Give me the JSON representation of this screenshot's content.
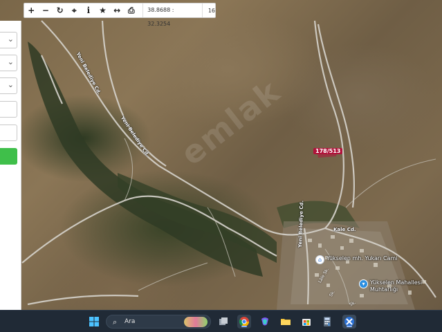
{
  "toolbar": {
    "buttons": [
      {
        "name": "zoom-in",
        "glyph": "+"
      },
      {
        "name": "zoom-out",
        "glyph": "−"
      },
      {
        "name": "refresh",
        "glyph": "↻"
      },
      {
        "name": "locate",
        "glyph": "⌖"
      },
      {
        "name": "info",
        "glyph": "i"
      },
      {
        "name": "favorite",
        "glyph": "★"
      },
      {
        "name": "measure",
        "glyph": "↔"
      },
      {
        "name": "print",
        "glyph": "⎙"
      }
    ],
    "coordinates": "38.8688 : 32.3254",
    "zoom_level": "16"
  },
  "map": {
    "roads": {
      "yeni_belediye_1": "Yeni Belediye Cd.",
      "yeni_belediye_2": "Yeni Belediye Cd.",
      "yeni_belediye_3": "Yeni Belediye Cd.",
      "kale": "Kale Cd."
    },
    "parcel_label": "178/513",
    "pois": {
      "mosque": "Yükselen mh. Yukarı Cami",
      "muhtarlik_line1": "Yükselen Mahallesi",
      "muhtarlik_line2": "Muhtarlığı"
    },
    "streets": {
      "s1": "Lâle Sk.",
      "s2": "Sk.",
      "s3": "Sk."
    },
    "watermark": "emlak",
    "colors": {
      "parcel": "#b0123a",
      "road": "#d9d9d9",
      "vegetation": "#2e3a22"
    }
  },
  "left_panel": {
    "select_chevrons": [
      "⌄",
      "⌄",
      "⌄"
    ],
    "accent": "#3fbf4a"
  },
  "taskbar": {
    "search_placeholder": "Ara",
    "apps": [
      "start-icon",
      "task-view-icon",
      "chrome-icon",
      "copilot-icon",
      "file-explorer-icon",
      "store-icon",
      "calculator-icon",
      "pinned-app-icon"
    ]
  }
}
